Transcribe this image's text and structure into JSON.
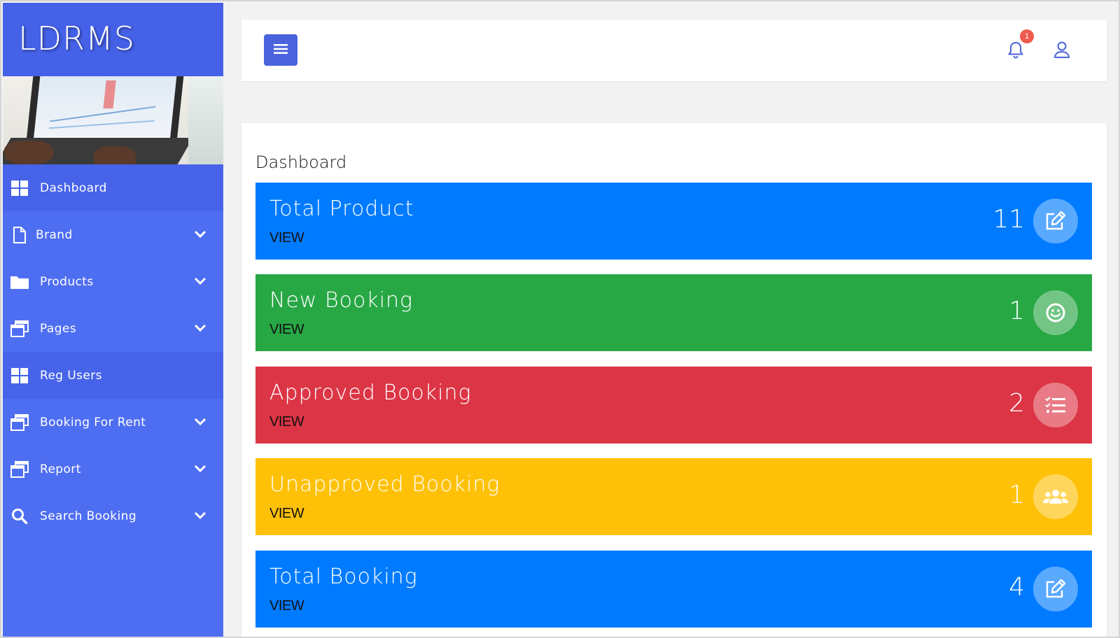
{
  "app": {
    "brand": "LDRMS"
  },
  "sidebar": {
    "items": [
      {
        "label": "Dashboard",
        "icon": "grid-icon",
        "active": true,
        "has_submenu": false
      },
      {
        "label": "Brand",
        "icon": "document-icon",
        "active": false,
        "has_submenu": true
      },
      {
        "label": "Products",
        "icon": "folder-icon",
        "active": false,
        "has_submenu": true
      },
      {
        "label": "Pages",
        "icon": "windows-icon",
        "active": false,
        "has_submenu": true
      },
      {
        "label": "Reg Users",
        "icon": "grid-icon",
        "active": true,
        "has_submenu": false
      },
      {
        "label": "Booking For Rent",
        "icon": "windows-icon",
        "active": false,
        "has_submenu": true
      },
      {
        "label": "Report",
        "icon": "windows-icon",
        "active": false,
        "has_submenu": true
      },
      {
        "label": "Search Booking",
        "icon": "search-icon",
        "active": false,
        "has_submenu": true
      }
    ]
  },
  "topbar": {
    "notification_count": "1",
    "icons": [
      "menu-icon",
      "bell-icon",
      "user-icon"
    ]
  },
  "main": {
    "title": "Dashboard",
    "cards": [
      {
        "title": "Total Product",
        "link": "VIEW",
        "count": "11",
        "icon": "edit-icon",
        "color": "#007bff"
      },
      {
        "title": "New Booking",
        "link": "VIEW",
        "count": "1",
        "icon": "smile-icon",
        "color": "#28a745"
      },
      {
        "title": "Approved Booking",
        "link": "VIEW",
        "count": "2",
        "icon": "list-icon",
        "color": "#dc3545"
      },
      {
        "title": "Unapproved Booking",
        "link": "VIEW",
        "count": "1",
        "icon": "users-icon",
        "color": "#ffc107"
      },
      {
        "title": "Total Booking",
        "link": "VIEW",
        "count": "4",
        "icon": "edit-icon",
        "color": "#007bff"
      }
    ]
  },
  "colors": {
    "sidebar": "#4e6ef2",
    "accent": "#4a63dc",
    "badge": "#f05b4f"
  }
}
